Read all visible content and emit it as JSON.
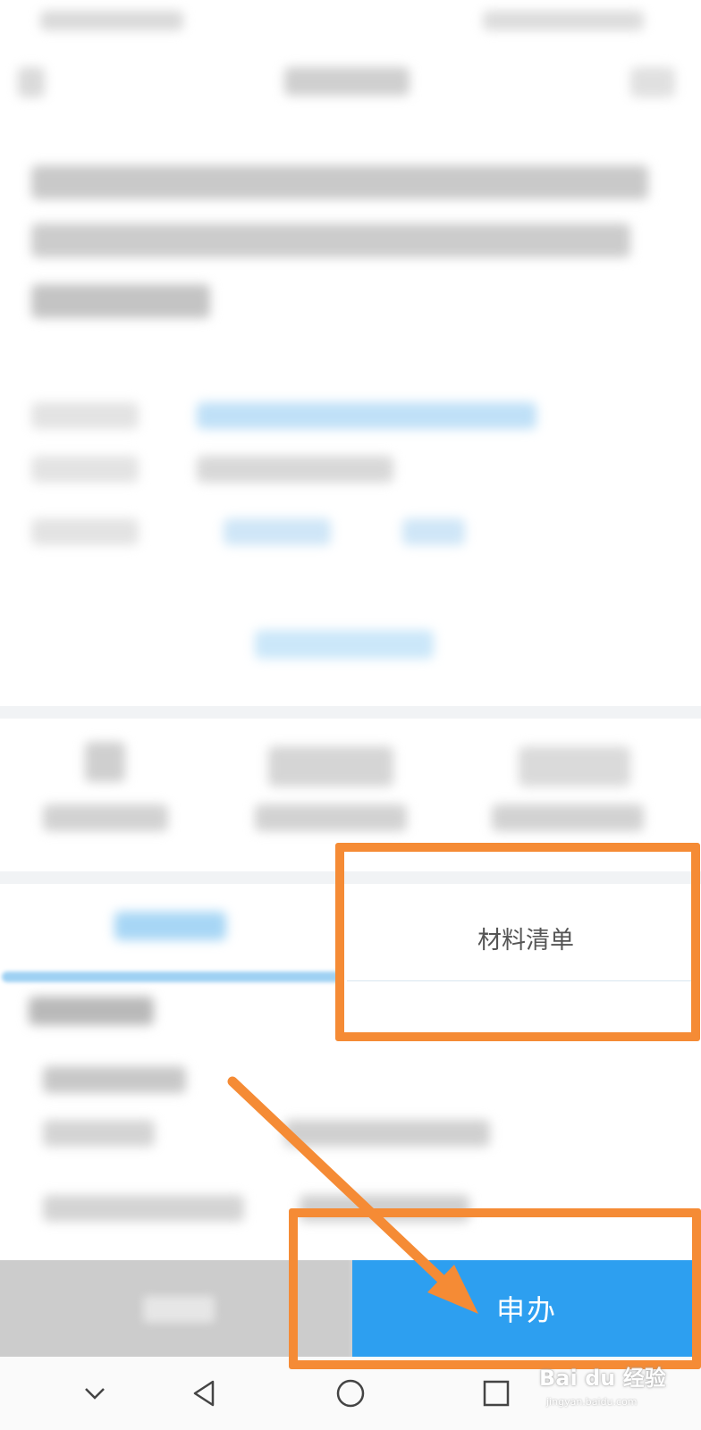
{
  "tabs": {
    "right_label": "材料清单"
  },
  "bottom_bar": {
    "apply_label": "申办"
  },
  "navbar": {
    "back_icon": "chevron-down-icon",
    "home_icon": "circle-icon",
    "recents_icon": "square-icon"
  },
  "watermark": {
    "text": "Bai du 经验",
    "sub": "jingyan.baidu.com"
  },
  "colors": {
    "accent": "#2d9ff0",
    "highlight": "#f58b35"
  }
}
